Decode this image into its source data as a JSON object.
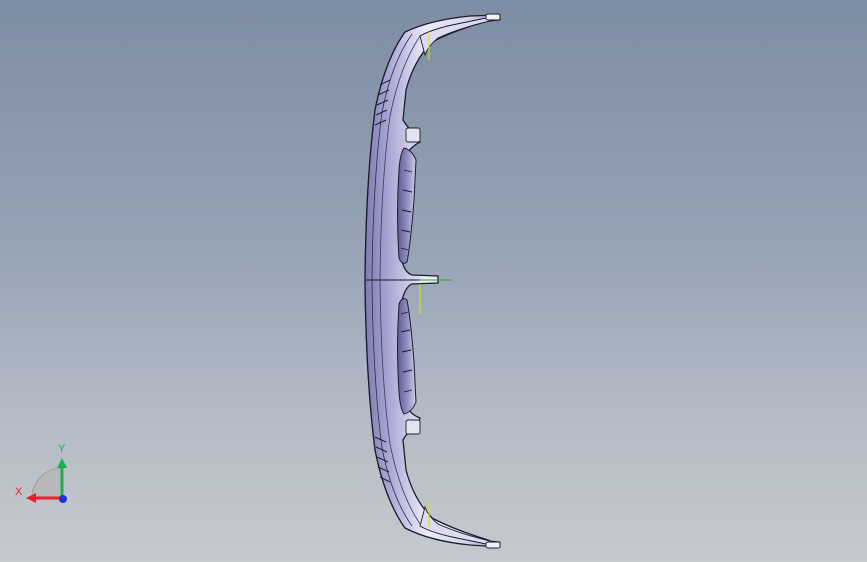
{
  "viewport": {
    "background_top": "#7d8da3",
    "background_bottom": "#c6c9ce"
  },
  "model": {
    "part": "bumper",
    "edge_color": "#1c1c2e",
    "face_color": "#e8e7f4",
    "shade_color": "#8f8dbe",
    "sketch_color": "#e0e000",
    "origin_x_color": "#2ea52e"
  },
  "triad": {
    "x_label": "X",
    "y_label": "Y",
    "x_color": "#e8202a",
    "y_color": "#19b24a",
    "z_color": "#2230d8"
  }
}
